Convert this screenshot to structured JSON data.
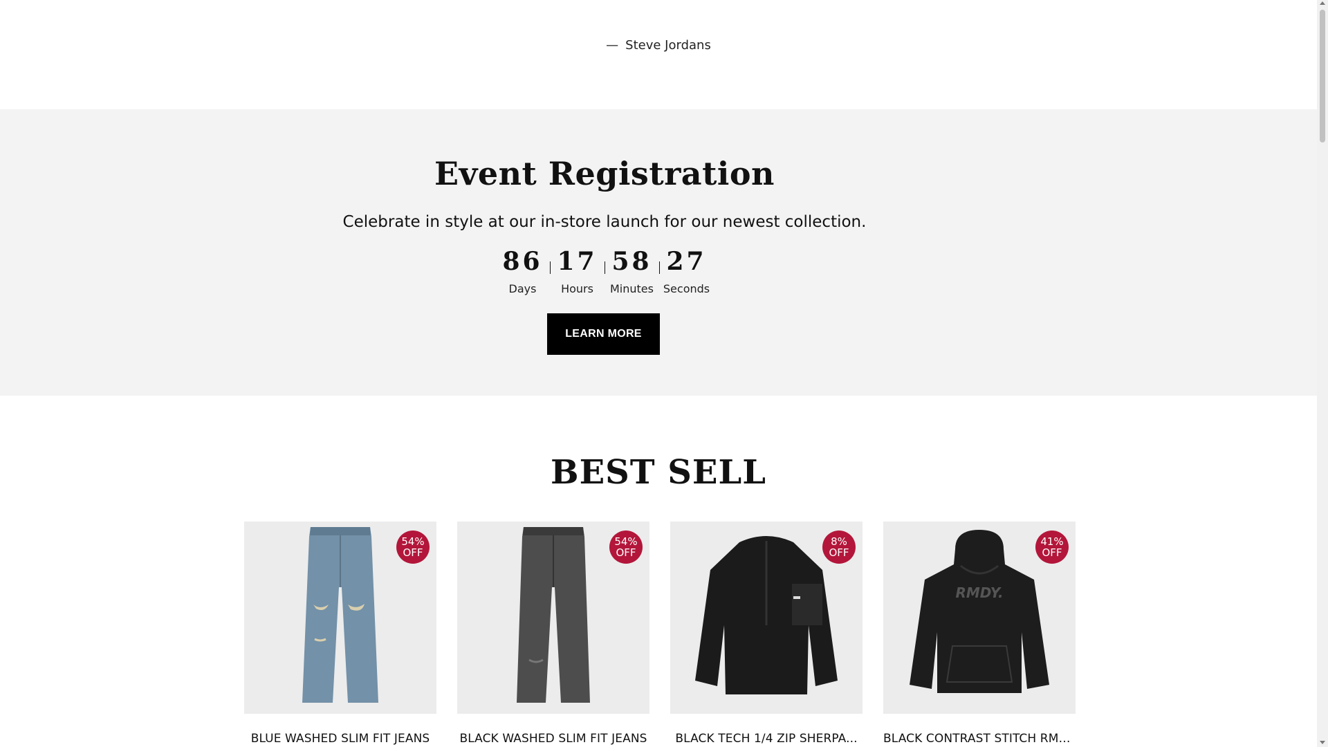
{
  "testimonial": {
    "dash": "—",
    "author": "Steve Jordans"
  },
  "event": {
    "title": "Event Registration",
    "subtitle": "Celebrate in style at our in-store launch for our newest collection.",
    "countdown": [
      {
        "value": "86",
        "label": "Days"
      },
      {
        "value": "17",
        "label": "Hours"
      },
      {
        "value": "58",
        "label": "Minutes"
      },
      {
        "value": "27",
        "label": "Seconds"
      }
    ],
    "button_label": "LEARN MORE"
  },
  "best_sell": {
    "title": "BEST SELL",
    "products": [
      {
        "name": "BLUE WASHED SLIM  FIT JEANS",
        "badge_pct": "54%",
        "badge_off": "OFF",
        "image": "blue-jeans",
        "color": "#6f8aa3"
      },
      {
        "name": "BLACK WASHED SLIM  FIT JEANS",
        "badge_pct": "54%",
        "badge_off": "OFF",
        "image": "black-jeans",
        "color": "#4a4a4a"
      },
      {
        "name": "BLACK TECH 1/4 ZIP SHERPA...",
        "badge_pct": "8%",
        "badge_off": "OFF",
        "image": "black-sherpa",
        "color": "#1a1a1a"
      },
      {
        "name": "BLACK CONTRAST STITCH  RMDY...",
        "badge_pct": "41%",
        "badge_off": "OFF",
        "image": "black-hoodie",
        "color": "#1c1c1c",
        "print": "RMDY."
      }
    ]
  },
  "colors": {
    "badge": "#b3163a",
    "event_bg": "#f3f3f3",
    "button_bg": "#000000",
    "card_bg": "#ececec"
  }
}
